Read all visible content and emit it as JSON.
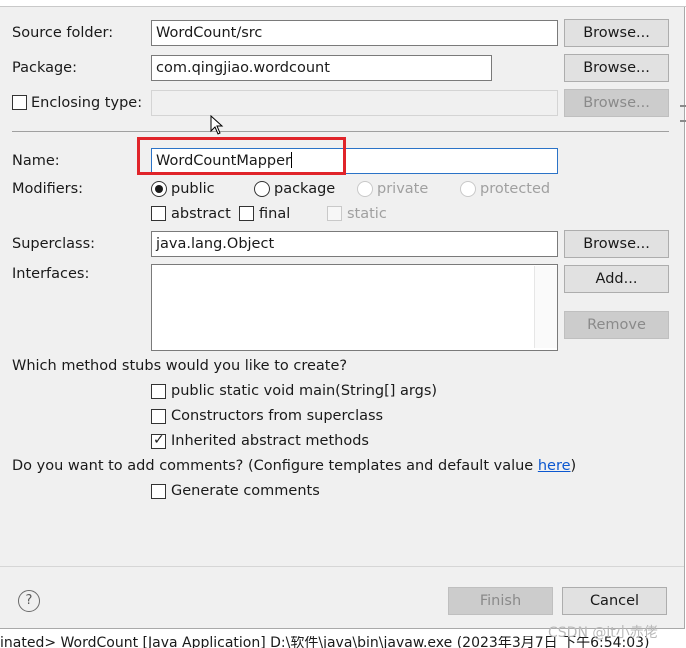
{
  "form": {
    "source_folder": {
      "label": "Source folder:",
      "value": "WordCount/src",
      "browse": "Browse..."
    },
    "package": {
      "label": "Package:",
      "value": "com.qingjiao.wordcount",
      "browse": "Browse..."
    },
    "enclosing_type": {
      "label": "Enclosing type:",
      "checked": false,
      "value": "",
      "browse": "Browse..."
    },
    "name": {
      "label": "Name:",
      "value": "WordCountMapper"
    },
    "modifiers": {
      "label": "Modifiers:",
      "access": [
        {
          "label": "public",
          "selected": true,
          "enabled": true
        },
        {
          "label": "package",
          "selected": false,
          "enabled": true
        },
        {
          "label": "private",
          "selected": false,
          "enabled": false
        },
        {
          "label": "protected",
          "selected": false,
          "enabled": false
        }
      ],
      "abstract": {
        "label": "abstract",
        "checked": false
      },
      "final": {
        "label": "final",
        "checked": false
      },
      "static": {
        "label": "static",
        "checked": false,
        "enabled": false
      }
    },
    "superclass": {
      "label": "Superclass:",
      "value": "java.lang.Object",
      "browse": "Browse..."
    },
    "interfaces": {
      "label": "Interfaces:",
      "add": "Add...",
      "remove": "Remove"
    },
    "stubs": {
      "question": "Which method stubs would you like to create?",
      "main": {
        "label": "public static void main(String[] args)",
        "checked": false
      },
      "constructors": {
        "label": "Constructors from superclass",
        "checked": false
      },
      "inherited": {
        "label": "Inherited abstract methods",
        "checked": true
      }
    },
    "comments": {
      "question_pre": "Do you want to add comments? (Configure templates and default value ",
      "link": "here",
      "question_post": ")",
      "generate": {
        "label": "Generate comments",
        "checked": false
      }
    }
  },
  "footer": {
    "help": "?",
    "finish": "Finish",
    "cancel": "Cancel"
  },
  "console_text": "inated> WordCount [Java Application] D:\\软件\\java\\bin\\javaw.exe (2023年3月7日 下午6:54:03)",
  "watermark": "CSDN @it小赤佬",
  "colors": {
    "highlight": "#e0242a",
    "link": "#0b57d0",
    "dialog_bg": "#f0f0f0"
  }
}
